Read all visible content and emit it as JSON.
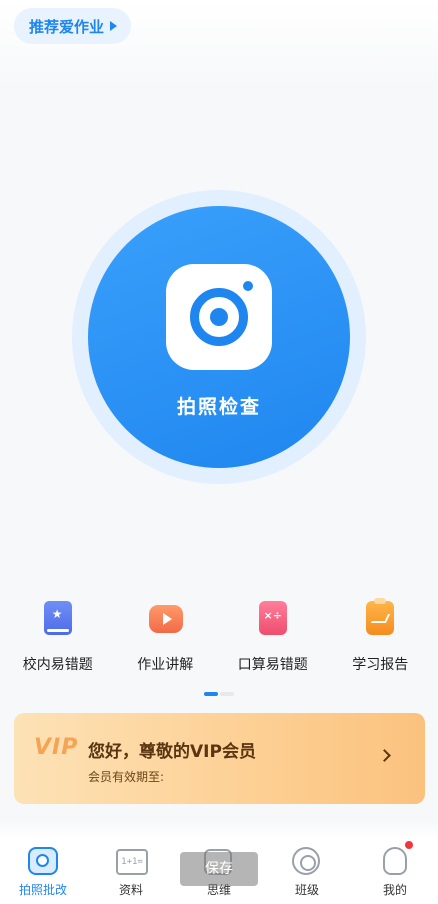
{
  "top_pill": {
    "label": "推荐爱作业"
  },
  "camera": {
    "label": "拍照检查",
    "accent": "#1f86f0"
  },
  "tools": [
    {
      "label": "校内易错题",
      "icon": "book-star-icon"
    },
    {
      "label": "作业讲解",
      "icon": "video-play-icon"
    },
    {
      "label": "口算易错题",
      "icon": "calculator-icon"
    },
    {
      "label": "学习报告",
      "icon": "report-chart-icon"
    }
  ],
  "carousel": {
    "pages": 2,
    "active": 1
  },
  "vip": {
    "logo": "VIP",
    "title": "您好，尊敬的VIP会员",
    "subtitle": "会员有效期至:"
  },
  "tabbar": [
    {
      "label": "拍照批改",
      "icon": "camera-tab-icon",
      "active": true
    },
    {
      "label": "资料",
      "icon": "book-tab-icon",
      "active": false,
      "icon_text": "1+1="
    },
    {
      "label": "思维",
      "icon": "think-tab-icon",
      "active": false
    },
    {
      "label": "班级",
      "icon": "class-tab-icon",
      "active": false
    },
    {
      "label": "我的",
      "icon": "profile-tab-icon",
      "active": false,
      "badge": true
    }
  ],
  "toast": {
    "label": "保存"
  }
}
